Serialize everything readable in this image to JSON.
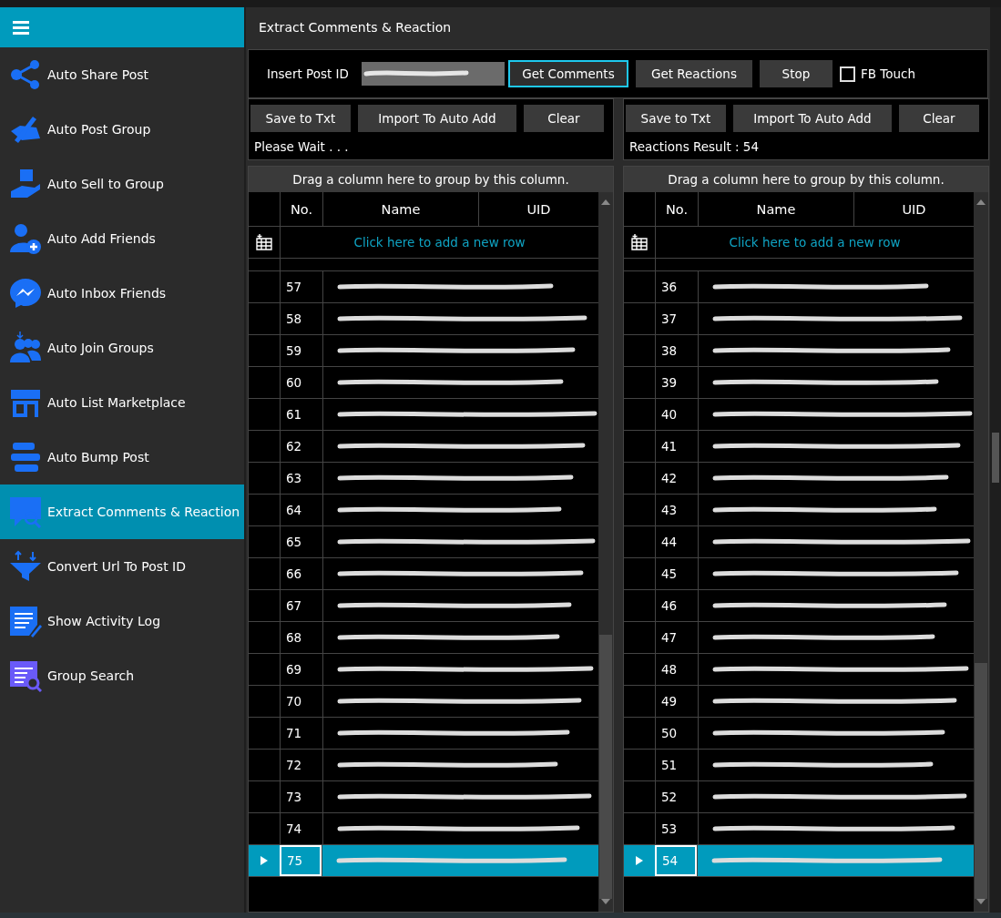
{
  "sidebar": {
    "items": [
      {
        "label": "Auto Share Post",
        "selected": false
      },
      {
        "label": "Auto Post Group",
        "selected": false
      },
      {
        "label": "Auto Sell to Group",
        "selected": false
      },
      {
        "label": "Auto Add Friends",
        "selected": false
      },
      {
        "label": "Auto Inbox Friends",
        "selected": false
      },
      {
        "label": "Auto Join Groups",
        "selected": false
      },
      {
        "label": "Auto List Marketplace",
        "selected": false
      },
      {
        "label": "Auto Bump Post",
        "selected": false
      },
      {
        "label": "Extract Comments & Reaction",
        "selected": true
      },
      {
        "label": "Convert Url To Post ID",
        "selected": false
      },
      {
        "label": "Show Activity Log",
        "selected": false
      },
      {
        "label": "Group Search",
        "selected": false
      }
    ]
  },
  "title": "Extract Comments & Reaction",
  "toolbar": {
    "label": "Insert Post ID",
    "buttons": [
      {
        "label": "Get Comments",
        "focused": true
      },
      {
        "label": "Get Reactions",
        "focused": false
      },
      {
        "label": "Stop",
        "focused": false
      }
    ],
    "checkbox": {
      "label": "FB Touch",
      "checked": false
    }
  },
  "panels": [
    {
      "buttons": [
        "Save to Txt",
        "Import To Auto Add",
        "Clear"
      ],
      "status": "Please Wait . . .",
      "group_hint": "Drag a column here to group by this column.",
      "columns": [
        "No.",
        "Name",
        "UID"
      ],
      "new_row": "Click here to add a new row",
      "rows": [
        {
          "no": "57",
          "selected": false
        },
        {
          "no": "58",
          "selected": false
        },
        {
          "no": "59",
          "selected": false
        },
        {
          "no": "60",
          "selected": false
        },
        {
          "no": "61",
          "selected": false
        },
        {
          "no": "62",
          "selected": false
        },
        {
          "no": "63",
          "selected": false
        },
        {
          "no": "64",
          "selected": false
        },
        {
          "no": "65",
          "selected": false
        },
        {
          "no": "66",
          "selected": false
        },
        {
          "no": "67",
          "selected": false
        },
        {
          "no": "68",
          "selected": false
        },
        {
          "no": "69",
          "selected": false
        },
        {
          "no": "70",
          "selected": false
        },
        {
          "no": "71",
          "selected": false
        },
        {
          "no": "72",
          "selected": false
        },
        {
          "no": "73",
          "selected": false
        },
        {
          "no": "74",
          "selected": false
        },
        {
          "no": "75",
          "selected": true
        }
      ]
    },
    {
      "buttons": [
        "Save to Txt",
        "Import To Auto Add",
        "Clear"
      ],
      "status": "Reactions Result : 54",
      "group_hint": "Drag a column here to group by this column.",
      "columns": [
        "No.",
        "Name",
        "UID"
      ],
      "new_row": "Click here to add a new row",
      "rows": [
        {
          "no": "36",
          "selected": false
        },
        {
          "no": "37",
          "selected": false
        },
        {
          "no": "38",
          "selected": false
        },
        {
          "no": "39",
          "selected": false
        },
        {
          "no": "40",
          "selected": false
        },
        {
          "no": "41",
          "selected": false
        },
        {
          "no": "42",
          "selected": false
        },
        {
          "no": "43",
          "selected": false
        },
        {
          "no": "44",
          "selected": false
        },
        {
          "no": "45",
          "selected": false
        },
        {
          "no": "46",
          "selected": false
        },
        {
          "no": "47",
          "selected": false
        },
        {
          "no": "48",
          "selected": false
        },
        {
          "no": "49",
          "selected": false
        },
        {
          "no": "50",
          "selected": false
        },
        {
          "no": "51",
          "selected": false
        },
        {
          "no": "52",
          "selected": false
        },
        {
          "no": "53",
          "selected": false
        },
        {
          "no": "54",
          "selected": true
        }
      ]
    }
  ]
}
